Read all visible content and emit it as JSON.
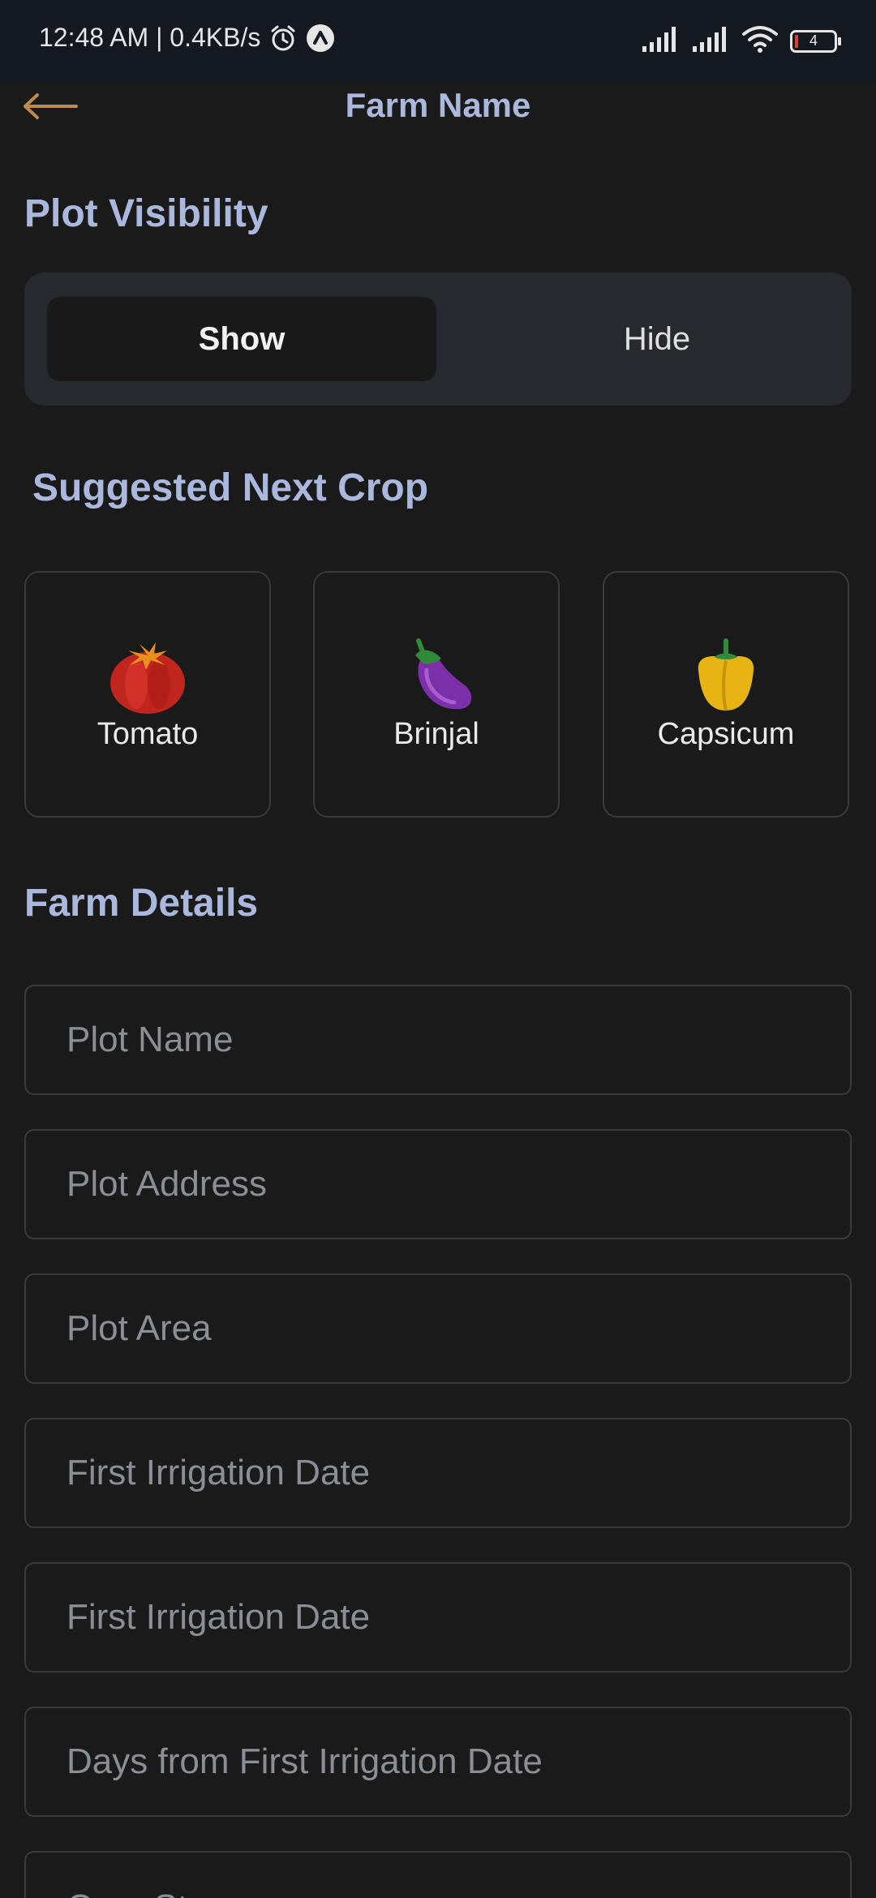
{
  "status_bar": {
    "time_speed": "12:48 AM | 0.4KB/s",
    "battery_level": "4",
    "icons": [
      "alarm-icon",
      "app-notification-icon",
      "signal-icon",
      "signal-icon",
      "wifi-icon",
      "battery-icon"
    ]
  },
  "header": {
    "title": "Farm Name",
    "back_icon": "arrow-left-icon",
    "accent_color": "#c08a4a"
  },
  "visibility": {
    "title": "Plot Visibility",
    "options": [
      "Show",
      "Hide"
    ],
    "selected": "Show"
  },
  "suggested": {
    "title": "Suggested Next Crop",
    "crops": [
      {
        "label": "Tomato",
        "icon": "tomato-icon"
      },
      {
        "label": "Brinjal",
        "icon": "eggplant-icon"
      },
      {
        "label": "Capsicum",
        "icon": "bell-pepper-icon"
      }
    ]
  },
  "farm_details": {
    "title": "Farm Details",
    "fields": [
      {
        "placeholder": "Plot Name"
      },
      {
        "placeholder": "Plot Address"
      },
      {
        "placeholder": "Plot Area"
      },
      {
        "placeholder": "First Irrigation Date"
      },
      {
        "placeholder": "First Irrigation Date"
      },
      {
        "placeholder": "Days from First Irrigation Date"
      },
      {
        "placeholder": "Crop Stage"
      }
    ]
  },
  "colors": {
    "background": "#1a1a1a",
    "heading": "#a9b8dc",
    "toggle_bg": "#262a2e",
    "placeholder": "#8a8f96"
  }
}
